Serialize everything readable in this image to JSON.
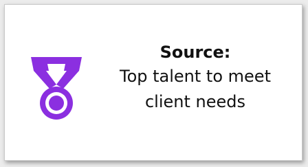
{
  "card": {
    "heading": "Source:",
    "body_line1": "Top talent to meet",
    "body_line2": "client needs"
  },
  "icon": {
    "name": "medal-icon",
    "color": "#8a2be2"
  }
}
